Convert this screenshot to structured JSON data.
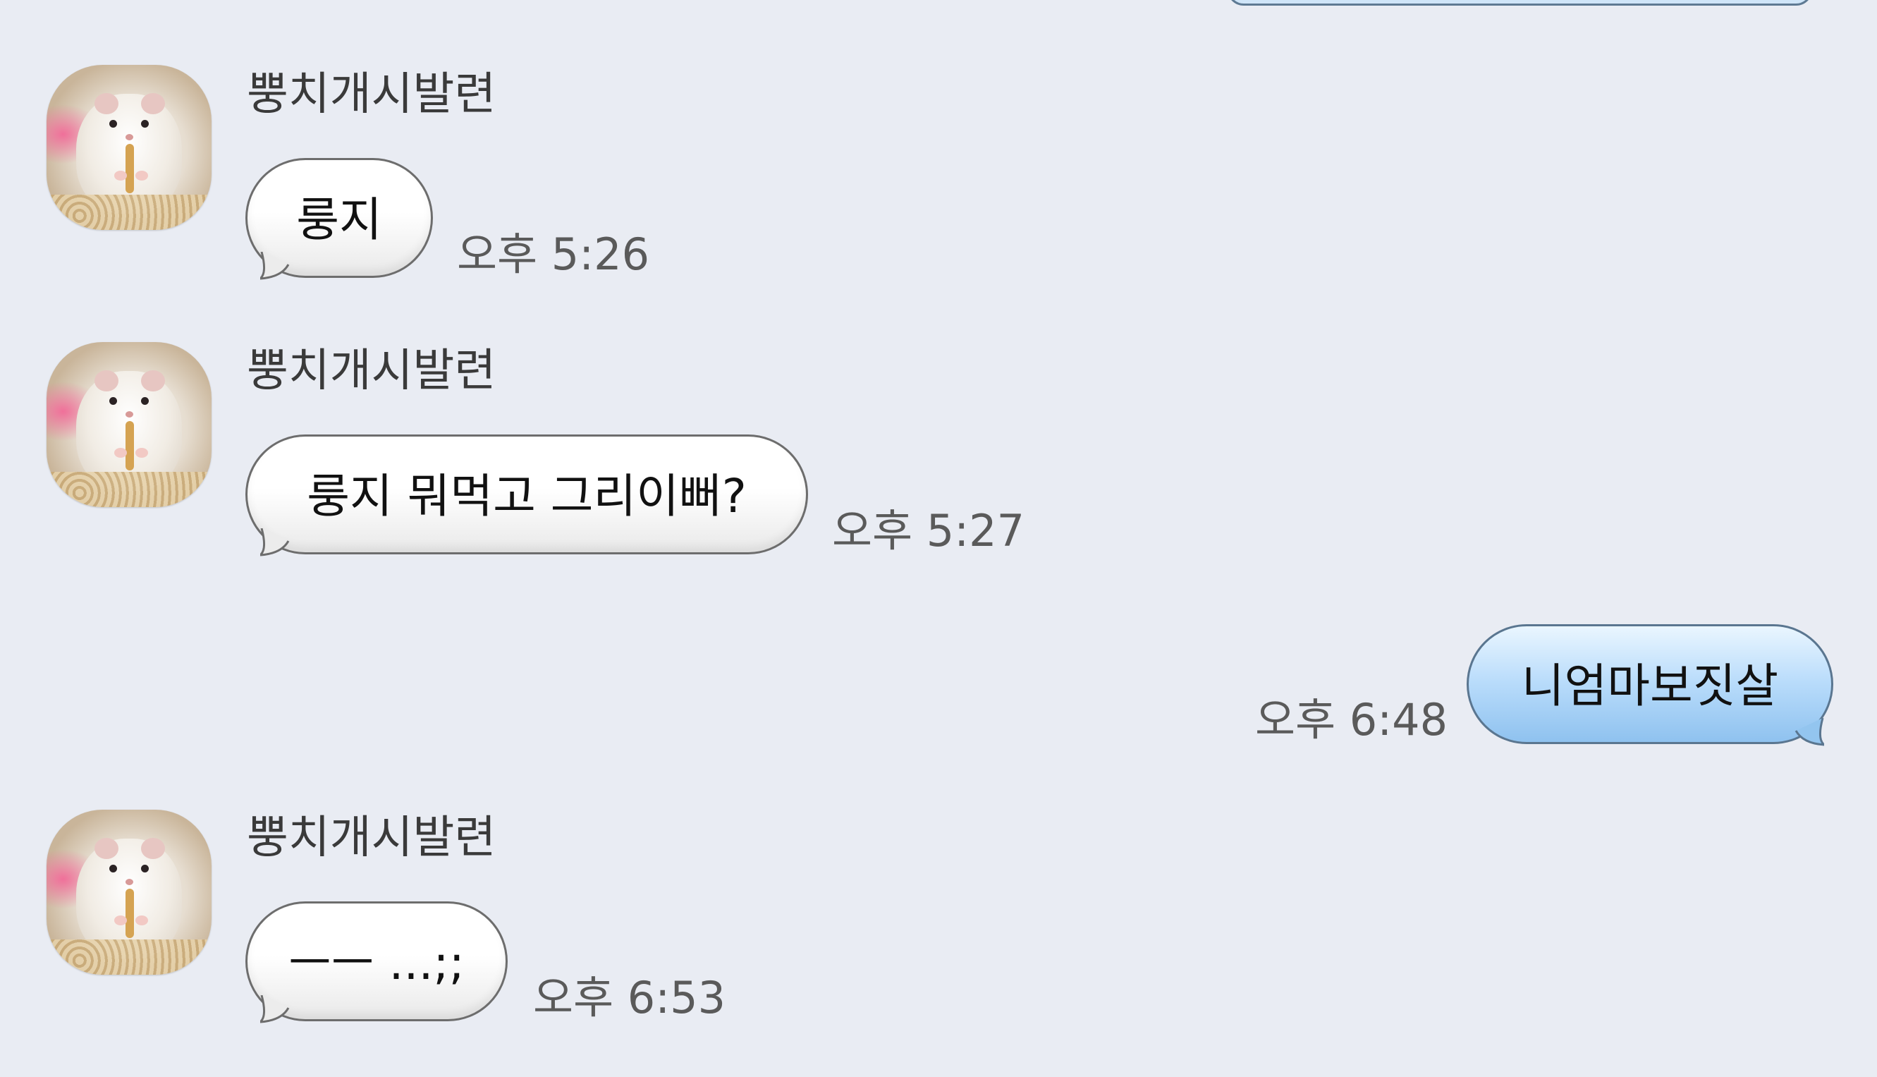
{
  "chat": {
    "messages": [
      {
        "sender": "뿡치개시발련",
        "text": "룽지",
        "time": "오후 5:26",
        "direction": "incoming"
      },
      {
        "sender": "뿡치개시발련",
        "text": "룽지 뭐먹고 그리이뻐?",
        "time": "오후 5:27",
        "direction": "incoming"
      },
      {
        "text": "니엄마보짓살",
        "time": "오후 6:48",
        "direction": "outgoing"
      },
      {
        "sender": "뿡치개시발련",
        "text": "ㅡㅡ ...;;",
        "time": "오후 6:53",
        "direction": "incoming"
      }
    ]
  },
  "colors": {
    "background": "#e9ecf3",
    "incoming_bubble": "#ffffff",
    "outgoing_bubble": "#a9d4f7"
  }
}
